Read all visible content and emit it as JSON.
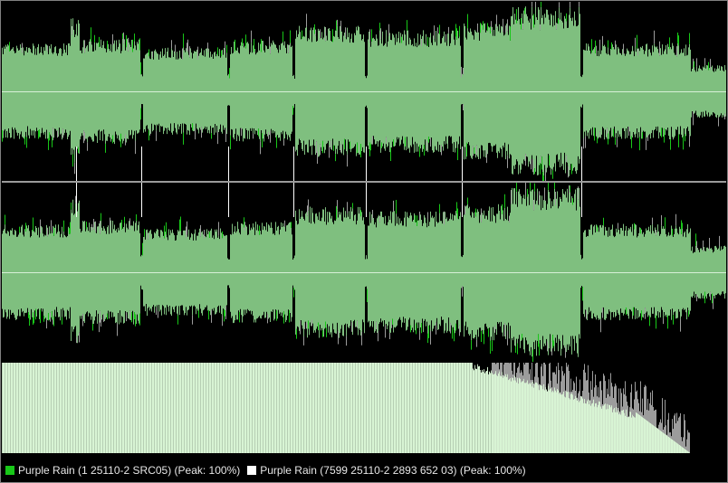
{
  "colors": {
    "track_a": "#18c818",
    "track_b": "#ffffff",
    "overlap": "#7fbf7f",
    "spectrum_fill": "#d8f4d4",
    "spectrum_diff": "#9c9c9c",
    "background": "#000000"
  },
  "legend": {
    "track_a_label": "Purple Rain (1 25110-2 SRC05) (Peak: 100%)",
    "track_b_label": "Purple Rain (7599 25110-2 2893 652 03) (Peak: 100%)"
  }
}
